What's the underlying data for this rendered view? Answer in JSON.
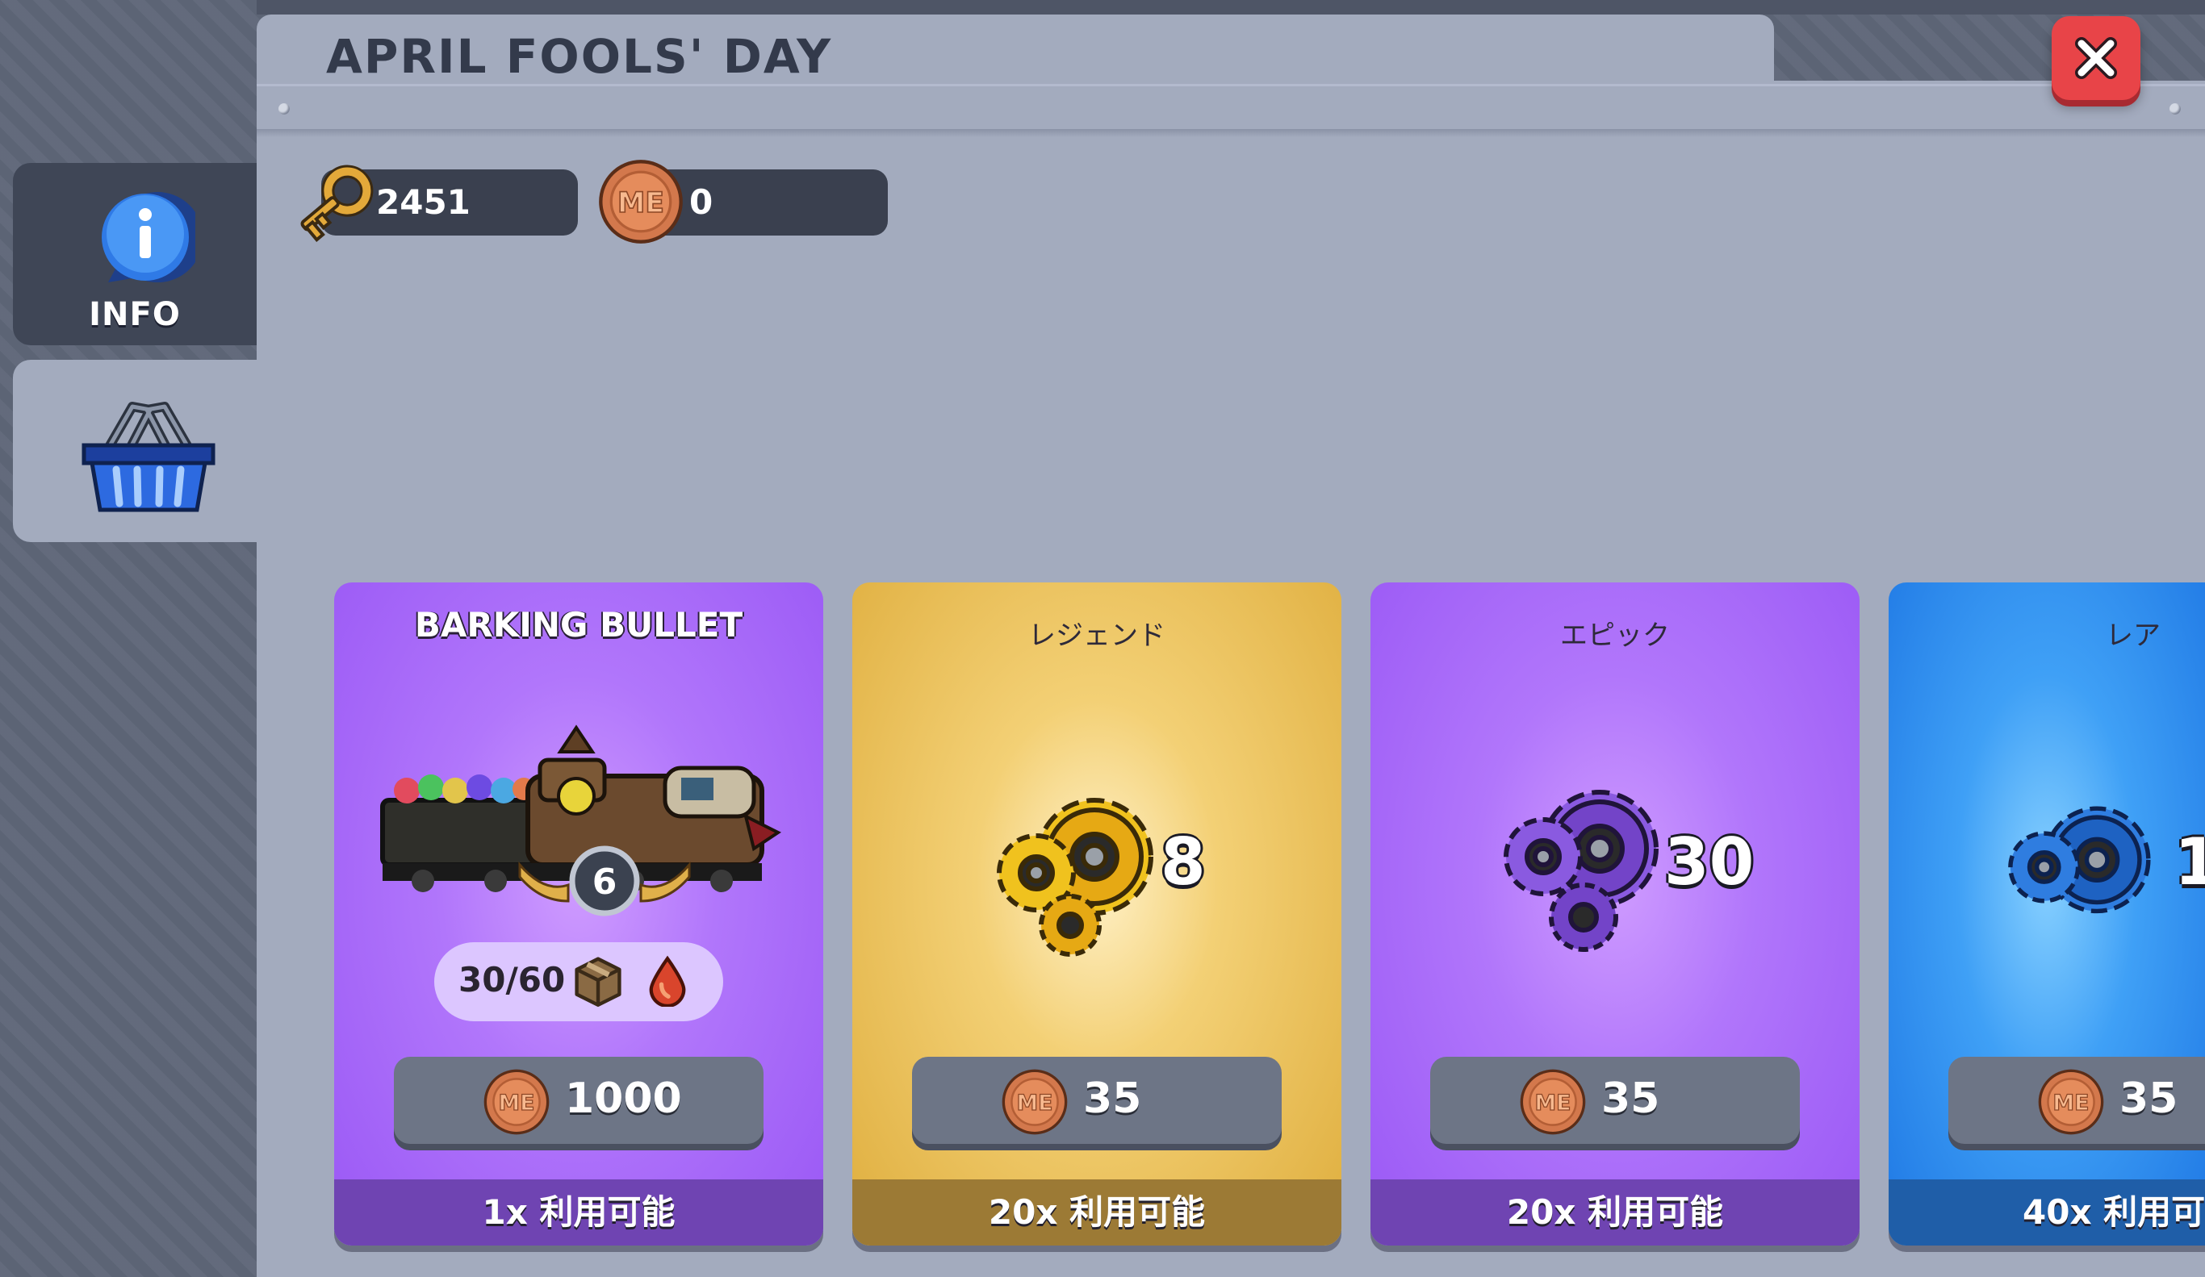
{
  "header": {
    "title": "APRIL FOOLS' DAY"
  },
  "sidebar": {
    "info_label": "INFO",
    "shop_icon": "basket-icon"
  },
  "currency": {
    "keys": "2451",
    "coins": "0",
    "coin_symbol": "ME"
  },
  "cards": [
    {
      "name": "BARKING BULLET",
      "level": "6",
      "stock": "30/60",
      "price": "1000",
      "availability": "1x 利用可能",
      "color": "#9a58f5"
    },
    {
      "rarity": "レジェンド",
      "count": "8",
      "price": "35",
      "availability": "20x 利用可能",
      "color": "#dfae3e"
    },
    {
      "rarity": "エピック",
      "count": "30",
      "price": "35",
      "availability": "20x 利用可能",
      "color": "#9a58f5"
    },
    {
      "rarity": "レア",
      "count": "1",
      "price": "35",
      "availability": "40x 利用可",
      "color": "#1f78e4"
    }
  ],
  "colors": {
    "close": "#e84448",
    "panel": "#a3abbe"
  }
}
